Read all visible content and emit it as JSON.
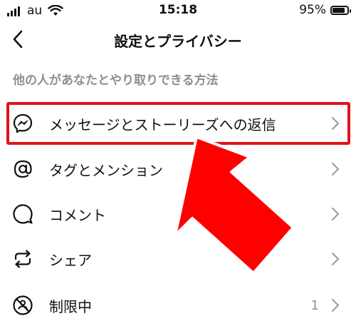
{
  "status_bar": {
    "carrier": "au",
    "time": "15:18",
    "battery_text": "95%",
    "battery_level": 0.95
  },
  "nav": {
    "back_icon": "chevron-left-icon",
    "title": "設定とプライバシー"
  },
  "section": {
    "header": "他の人があなたとやり取りできる方法"
  },
  "rows": [
    {
      "label": "メッセージとストーリーズへの返信",
      "icon": "messenger-icon",
      "count": ""
    },
    {
      "label": "タグとメンション",
      "icon": "at-sign-icon",
      "count": ""
    },
    {
      "label": "コメント",
      "icon": "comment-bubble-icon",
      "count": ""
    },
    {
      "label": "シェア",
      "icon": "share-repost-icon",
      "count": ""
    },
    {
      "label": "制限中",
      "icon": "restricted-icon",
      "count": "1"
    }
  ],
  "annotation": {
    "highlight_color": "#e0121a",
    "arrow_color": "#ff0000"
  }
}
